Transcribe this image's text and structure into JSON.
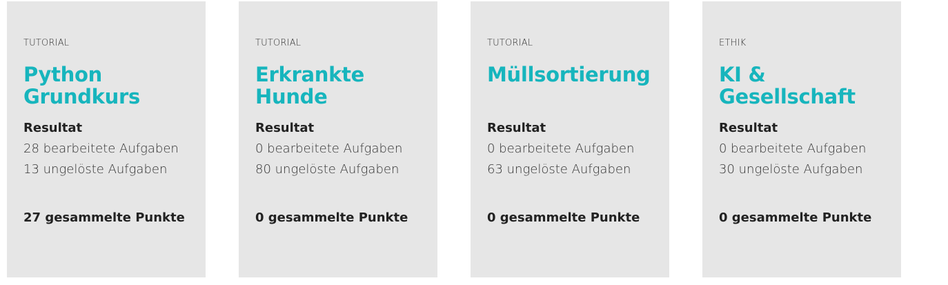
{
  "accent_color": "#17b5bd",
  "card_background": "#e6e6e6",
  "cards": [
    {
      "category": "TUTORIAL",
      "title": "Python Grundkurs",
      "result_label": "Resultat",
      "solved": "28 bearbeitete Aufgaben",
      "unsolved": "13 ungelöste Aufgaben",
      "points": "27 gesammelte Punkte"
    },
    {
      "category": "TUTORIAL",
      "title": "Erkrankte Hunde",
      "result_label": "Resultat",
      "solved": "0 bearbeitete Aufgaben",
      "unsolved": "80 ungelöste Aufgaben",
      "points": "0 gesammelte Punkte"
    },
    {
      "category": "TUTORIAL",
      "title": "Müllsortierung",
      "result_label": "Resultat",
      "solved": "0 bearbeitete Aufgaben",
      "unsolved": "63 ungelöste Aufgaben",
      "points": "0 gesammelte Punkte"
    },
    {
      "category": "ETHIK",
      "title": "KI & Gesellschaft",
      "result_label": "Resultat",
      "solved": "0 bearbeitete Aufgaben",
      "unsolved": "30 ungelöste Aufgaben",
      "points": "0 gesammelte Punkte"
    }
  ]
}
